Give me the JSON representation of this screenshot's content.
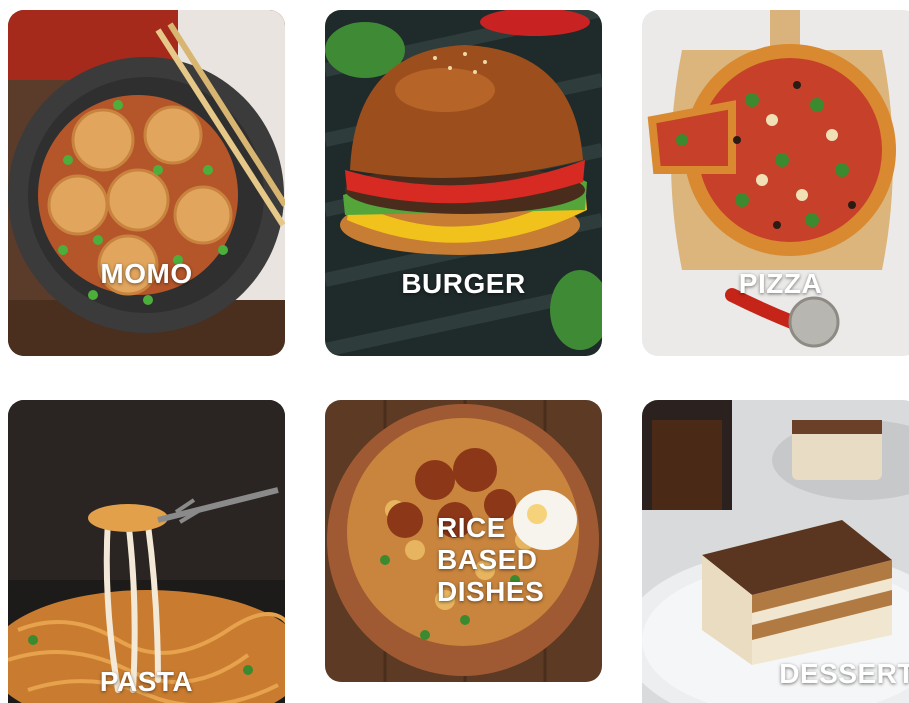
{
  "categories": [
    {
      "label": "MOMO",
      "image": "momo-dumplings-photo"
    },
    {
      "label": "BURGER",
      "image": "cheeseburger-photo"
    },
    {
      "label": "PIZZA",
      "image": "pizza-on-board-photo"
    },
    {
      "label": "PASTA",
      "image": "cheesy-pasta-fork-photo"
    },
    {
      "label": "RICE\nBASED\nDISHES",
      "image": "biryani-bowl-photo"
    },
    {
      "label": "DESSERT",
      "image": "tiramisu-slice-photo"
    }
  ]
}
